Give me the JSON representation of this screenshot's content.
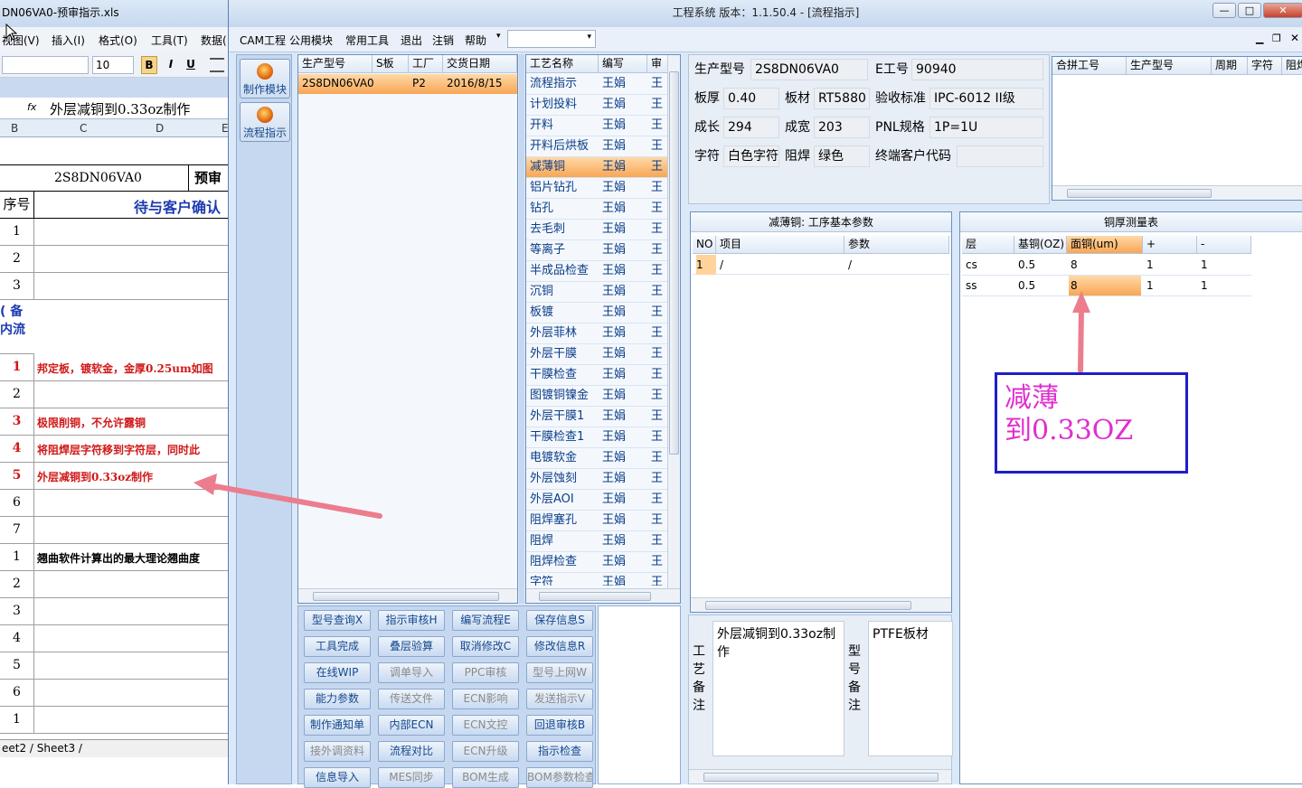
{
  "excel": {
    "title": "DN06VA0-预审指示.xls",
    "menu": [
      "视图(V)",
      "插入(I)",
      "格式(O)",
      "工具(T)",
      "数据("
    ],
    "font_size": "10",
    "fmt_buttons": [
      "B",
      "I",
      "U"
    ],
    "formula_fx": "fx",
    "formula_value": "外层减铜到0.33oz制作",
    "col_headers": [
      "B",
      "C",
      "D",
      "E"
    ],
    "header_model": "2S8DN06VA0",
    "header_right": "预审",
    "col_seq": "序号",
    "col_confirm": "待与客户确认",
    "note_label_1": "( 备",
    "note_label_2": "内流",
    "rows": [
      {
        "num": "1",
        "text": "",
        "red": false
      },
      {
        "num": "2",
        "text": "",
        "red": false
      },
      {
        "num": "3",
        "text": "",
        "red": false
      },
      {
        "num": "1",
        "text": "邦定板，镀软金，金厚0.25um如图",
        "red": true
      },
      {
        "num": "2",
        "text": "",
        "red": false
      },
      {
        "num": "3",
        "text": "极限削铜，不允许露铜",
        "red": true
      },
      {
        "num": "4",
        "text": "将阻焊层字符移到字符层，同时此",
        "red": true
      },
      {
        "num": "5",
        "text": "外层减铜到0.33oz制作",
        "red": true
      },
      {
        "num": "6",
        "text": "",
        "red": false
      },
      {
        "num": "7",
        "text": "",
        "red": false
      },
      {
        "num": "1",
        "text": "翘曲软件计算出的最大理论翘曲度",
        "red": false
      },
      {
        "num": "2",
        "text": "",
        "red": false
      },
      {
        "num": "3",
        "text": "",
        "red": false
      },
      {
        "num": "4",
        "text": "",
        "red": false
      },
      {
        "num": "5",
        "text": "",
        "red": false
      },
      {
        "num": "6",
        "text": "",
        "red": false
      },
      {
        "num": "1",
        "text": "",
        "red": false
      }
    ],
    "sheet_tabs": "eet2 / Sheet3 /"
  },
  "app": {
    "title": "工程系统   版本：1.1.50.4 - [流程指示]",
    "menu": [
      "CAM工程",
      "公用模块",
      "常用工具",
      "退出",
      "注销",
      "帮助"
    ],
    "sidebar": [
      {
        "label": "制作模块",
        "icon": "fire-icon"
      },
      {
        "label": "流程指示",
        "icon": "flow-icon"
      }
    ],
    "product_table": {
      "headers": [
        "生产型号",
        "S板",
        "工厂",
        "交货日期"
      ],
      "rows": [
        [
          "2S8DN06VA0",
          "",
          "P2",
          "2016/8/15"
        ]
      ]
    },
    "process_table": {
      "headers": [
        "工艺名称",
        "编写",
        "审"
      ],
      "rows": [
        {
          "name": "流程指示",
          "author": "王娟",
          "rev": "王"
        },
        {
          "name": "计划投料",
          "author": "王娟",
          "rev": "王"
        },
        {
          "name": "开料",
          "author": "王娟",
          "rev": "王"
        },
        {
          "name": "开料后烘板",
          "author": "王娟",
          "rev": "王"
        },
        {
          "name": "减薄铜",
          "author": "王娟",
          "rev": "王",
          "selected": true
        },
        {
          "name": "铝片钻孔",
          "author": "王娟",
          "rev": "王"
        },
        {
          "name": "钻孔",
          "author": "王娟",
          "rev": "王"
        },
        {
          "name": "去毛刺",
          "author": "王娟",
          "rev": "王"
        },
        {
          "name": "等离子",
          "author": "王娟",
          "rev": "王"
        },
        {
          "name": "半成品检查",
          "author": "王娟",
          "rev": "王"
        },
        {
          "name": "沉铜",
          "author": "王娟",
          "rev": "王"
        },
        {
          "name": "板镀",
          "author": "王娟",
          "rev": "王"
        },
        {
          "name": "外层菲林",
          "author": "王娟",
          "rev": "王"
        },
        {
          "name": "外层干膜",
          "author": "王娟",
          "rev": "王"
        },
        {
          "name": "干膜检查",
          "author": "王娟",
          "rev": "王"
        },
        {
          "name": "图镀铜镍金",
          "author": "王娟",
          "rev": "王"
        },
        {
          "name": "外层干膜1",
          "author": "王娟",
          "rev": "王"
        },
        {
          "name": "干膜检查1",
          "author": "王娟",
          "rev": "王"
        },
        {
          "name": "电镀软金",
          "author": "王娟",
          "rev": "王"
        },
        {
          "name": "外层蚀刻",
          "author": "王娟",
          "rev": "王"
        },
        {
          "name": "外层AOI",
          "author": "王娟",
          "rev": "王"
        },
        {
          "name": "阻焊塞孔",
          "author": "王娟",
          "rev": "王"
        },
        {
          "name": "阻焊",
          "author": "王娟",
          "rev": "王"
        },
        {
          "name": "阻焊检查",
          "author": "王娟",
          "rev": "王"
        },
        {
          "name": "字符",
          "author": "王娟",
          "rev": "王"
        }
      ]
    },
    "buttons": [
      [
        {
          "label": "型号查询X",
          "enabled": true
        },
        {
          "label": "指示审核H",
          "enabled": true
        },
        {
          "label": "编写流程E",
          "enabled": true
        },
        {
          "label": "保存信息S",
          "enabled": true
        }
      ],
      [
        {
          "label": "工具完成",
          "enabled": true
        },
        {
          "label": "叠层验算",
          "enabled": true
        },
        {
          "label": "取消修改C",
          "enabled": true
        },
        {
          "label": "修改信息R",
          "enabled": true
        }
      ],
      [
        {
          "label": "在线WIP",
          "enabled": true
        },
        {
          "label": "调单导入",
          "enabled": false
        },
        {
          "label": "PPC审核",
          "enabled": false
        },
        {
          "label": "型号上网W",
          "enabled": false
        }
      ],
      [
        {
          "label": "能力参数",
          "enabled": true
        },
        {
          "label": "传送文件",
          "enabled": false
        },
        {
          "label": "ECN影响",
          "enabled": false
        },
        {
          "label": "发送指示V",
          "enabled": false
        }
      ],
      [
        {
          "label": "制作通知单",
          "enabled": true
        },
        {
          "label": "内部ECN",
          "enabled": true
        },
        {
          "label": "ECN文控",
          "enabled": false
        },
        {
          "label": "回退审核B",
          "enabled": true
        }
      ],
      [
        {
          "label": "接外调资料",
          "enabled": false
        },
        {
          "label": "流程对比",
          "enabled": true
        },
        {
          "label": "ECN升级",
          "enabled": false
        },
        {
          "label": "指示检查",
          "enabled": true
        }
      ],
      [
        {
          "label": "信息导入",
          "enabled": true
        },
        {
          "label": "MES同步",
          "enabled": false
        },
        {
          "label": "BOM生成",
          "enabled": false
        },
        {
          "label": "BOM参数检查",
          "enabled": false
        }
      ]
    ],
    "info": {
      "model_label": "生产型号",
      "model": "2S8DN06VA0",
      "e_label": "E工号",
      "e_no": "90940",
      "thick_label": "板厚",
      "thick": "0.40",
      "material_label": "板材",
      "material": "RT5880",
      "std_label": "验收标准",
      "std": "IPC-6012 II级",
      "len_label": "成长",
      "len": "294",
      "wid_label": "成宽",
      "wid": "203",
      "pnl_label": "PNL规格",
      "pnl": "1P=1U",
      "char_label": "字符",
      "char": "白色字符",
      "mask_label": "阻焊",
      "mask": "绿色",
      "cust_label": "终端客户代码",
      "cust": ""
    },
    "merge_table": {
      "headers": [
        "合拼工号",
        "生产型号",
        "周期",
        "字符",
        "阻焊"
      ]
    },
    "params": {
      "title": "减薄铜: 工序基本参数",
      "headers": [
        "NO",
        "项目",
        "参数"
      ],
      "rows": [
        [
          "1",
          "/",
          "/"
        ]
      ]
    },
    "copper": {
      "title": "铜厚测量表",
      "headers": [
        "层",
        "基铜(OZ)",
        "面铜(um)",
        "+",
        "-"
      ],
      "rows": [
        [
          "cs",
          "0.5",
          "8",
          "1",
          "1"
        ],
        [
          "ss",
          "0.5",
          "8",
          "1",
          "1"
        ]
      ]
    },
    "remarks": {
      "craft_label": "工艺备注",
      "craft_text": "外层减铜到0.33oz制作",
      "model_label": "型号备注",
      "model_text": "PTFE板材"
    },
    "annotation": {
      "line1": "减薄",
      "line2": "到0.33OZ"
    }
  }
}
